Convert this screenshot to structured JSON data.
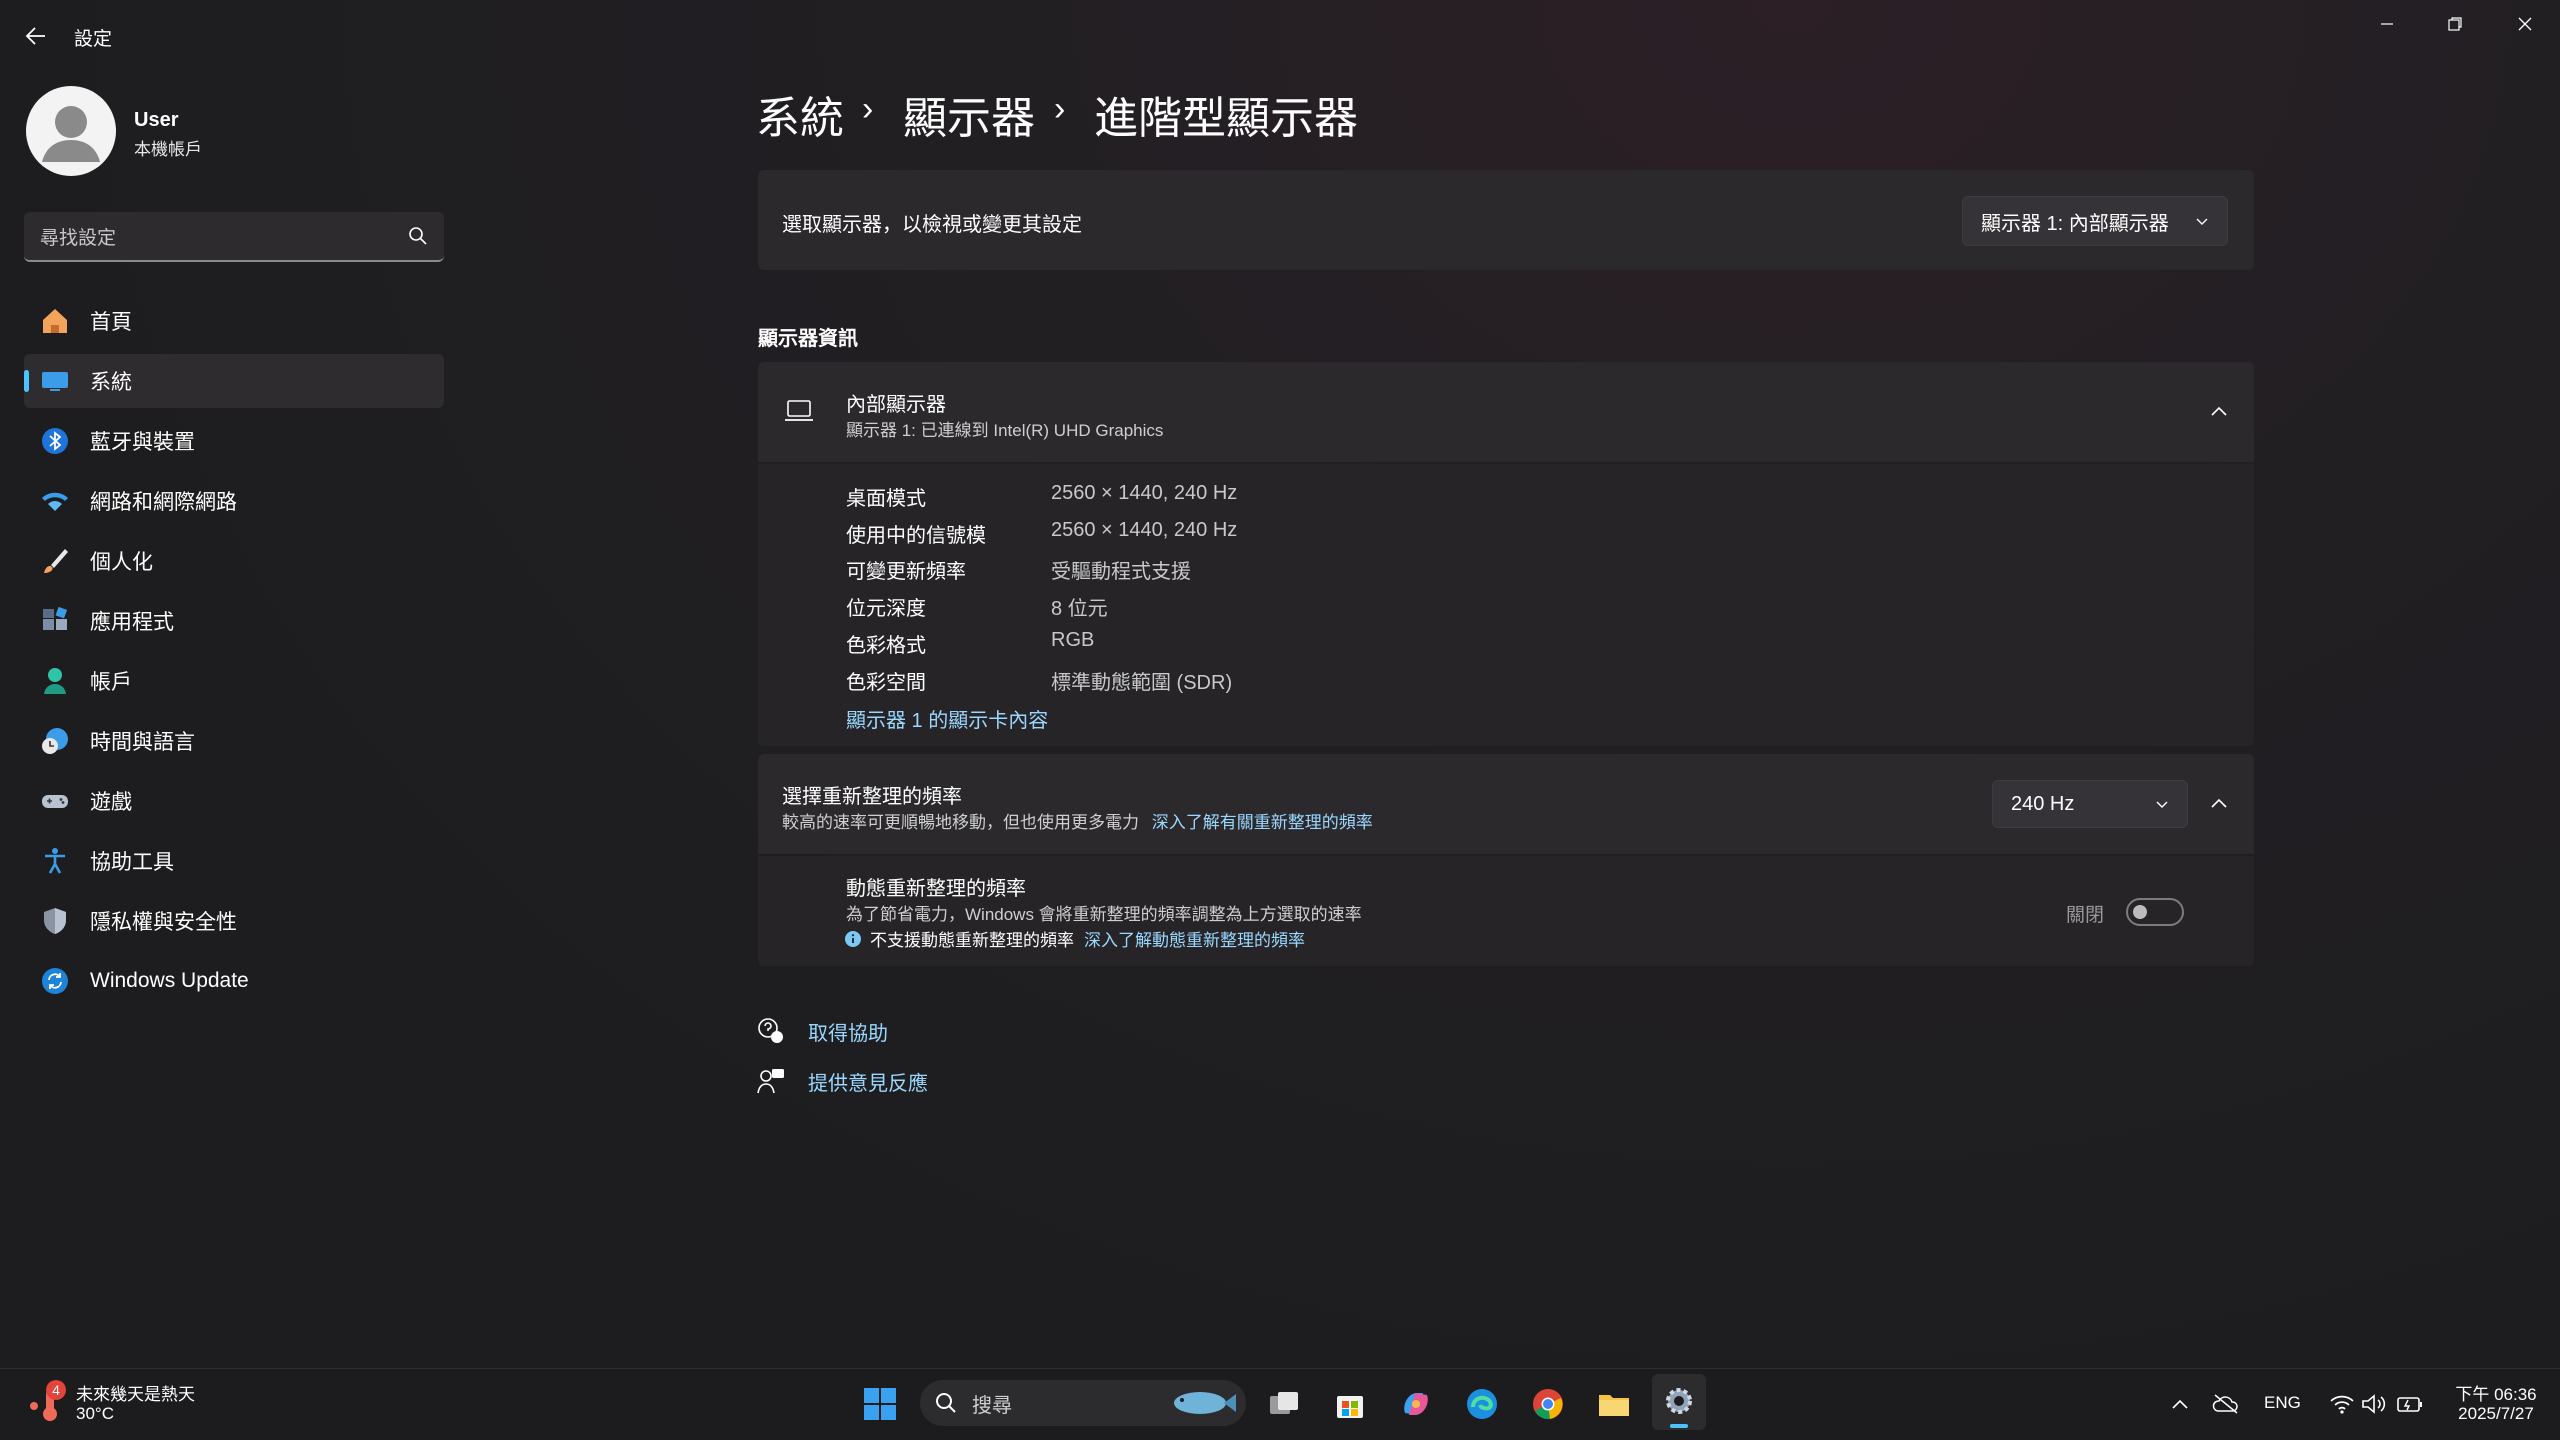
{
  "window": {
    "title": "設定"
  },
  "user": {
    "name": "User",
    "account_type": "本機帳戶"
  },
  "search": {
    "placeholder": "尋找設定"
  },
  "nav": {
    "items": [
      {
        "label": "首頁",
        "icon": "home-icon"
      },
      {
        "label": "系統",
        "icon": "monitor-icon",
        "active": true
      },
      {
        "label": "藍牙與裝置",
        "icon": "bluetooth-icon"
      },
      {
        "label": "網路和網際網路",
        "icon": "wifi-icon"
      },
      {
        "label": "個人化",
        "icon": "brush-icon"
      },
      {
        "label": "應用程式",
        "icon": "apps-icon"
      },
      {
        "label": "帳戶",
        "icon": "person-icon"
      },
      {
        "label": "時間與語言",
        "icon": "clock-globe-icon"
      },
      {
        "label": "遊戲",
        "icon": "gamepad-icon"
      },
      {
        "label": "協助工具",
        "icon": "accessibility-icon"
      },
      {
        "label": "隱私權與安全性",
        "icon": "shield-icon"
      },
      {
        "label": "Windows Update",
        "icon": "update-icon"
      }
    ]
  },
  "breadcrumb": {
    "level1": "系統",
    "level2": "顯示器",
    "level3": "進階型顯示器",
    "separator": "›"
  },
  "select_display": {
    "label": "選取顯示器，以檢視或變更其設定",
    "value": "顯示器 1: 內部顯示器"
  },
  "display_info": {
    "section_title": "顯示器資訊",
    "header_title": "內部顯示器",
    "header_subtitle": "顯示器 1: 已連線到 Intel(R) UHD Graphics",
    "rows": [
      {
        "label": "桌面模式",
        "value": "2560 × 1440, 240 Hz"
      },
      {
        "label": "使用中的信號模",
        "value": "2560 × 1440, 240 Hz"
      },
      {
        "label": "可變更新頻率",
        "value": "受驅動程式支援"
      },
      {
        "label": "位元深度",
        "value": "8 位元"
      },
      {
        "label": "色彩格式",
        "value": "RGB"
      },
      {
        "label": "色彩空間",
        "value": "標準動態範圍 (SDR)"
      }
    ],
    "adapter_link": "顯示器 1 的顯示卡內容"
  },
  "refresh_rate": {
    "title": "選擇重新整理的頻率",
    "description": "較高的速率可更順暢地移動，但也使用更多電力",
    "learn_more": "深入了解有關重新整理的頻率",
    "value": "240 Hz"
  },
  "dynamic_refresh": {
    "title": "動態重新整理的頻率",
    "description": "為了節省電力，Windows 會將重新整理的頻率調整為上方選取的速率",
    "not_supported": "不支援動態重新整理的頻率",
    "learn_more": "深入了解動態重新整理的頻率",
    "toggle_state": "關閉"
  },
  "help": {
    "get_help": "取得協助",
    "feedback": "提供意見反應"
  },
  "taskbar": {
    "weather_text": "未來幾天是熱天",
    "weather_temp": "30°C",
    "weather_badge": "4",
    "search_placeholder": "搜尋",
    "language": "ENG",
    "time": "下午 06:36",
    "date": "2025/7/27"
  },
  "colors": {
    "accent": "#4cc2ff",
    "link": "#9ad8ff",
    "card": "#2b292c",
    "background": "#1f1d20"
  }
}
